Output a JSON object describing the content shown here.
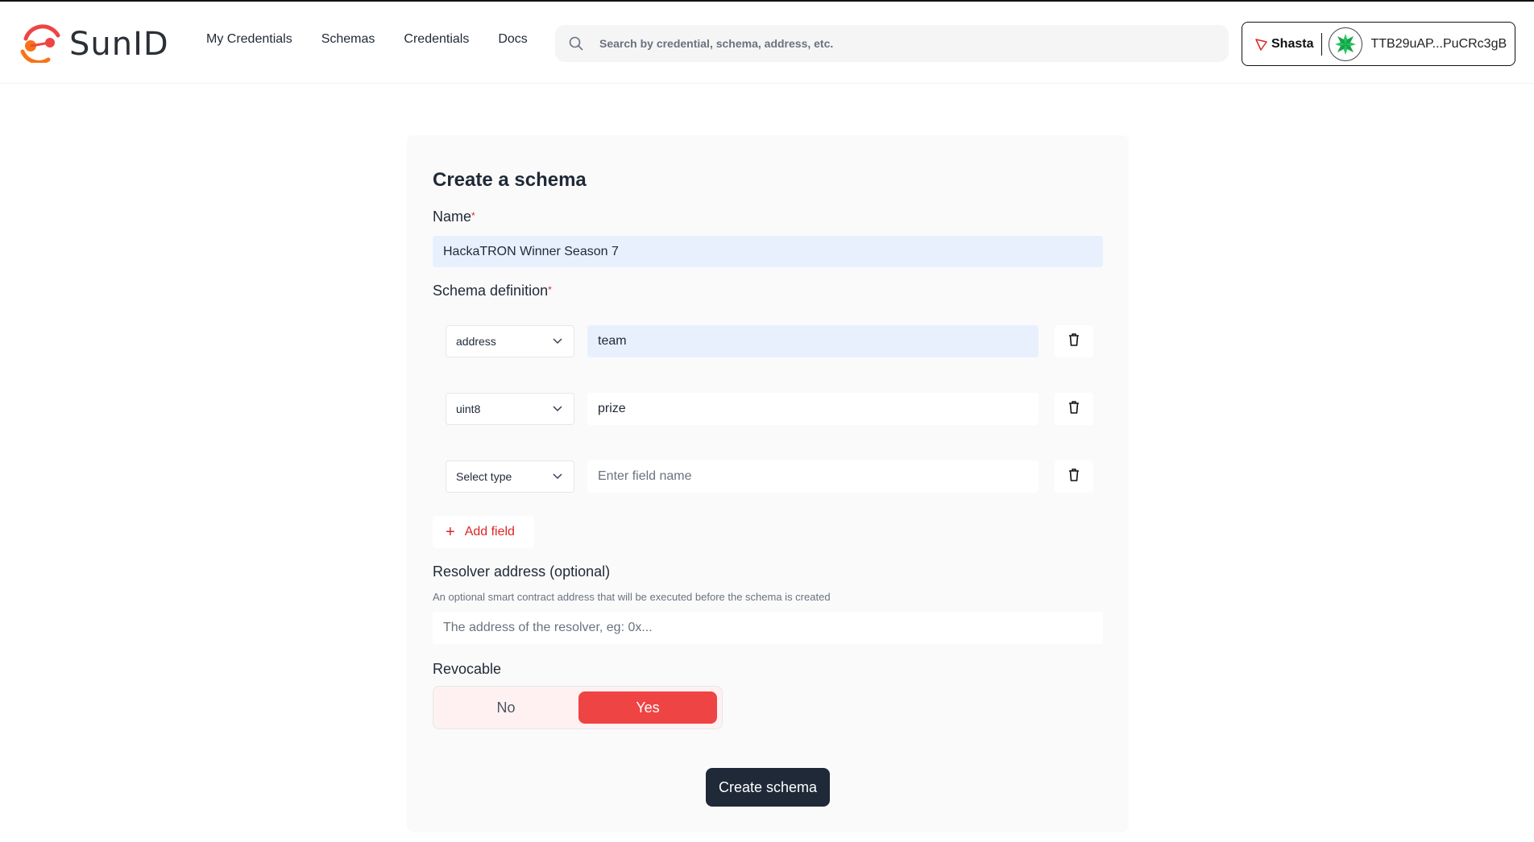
{
  "brand": {
    "name": "SunID"
  },
  "nav": {
    "items": [
      {
        "label": "My Credentials"
      },
      {
        "label": "Schemas"
      },
      {
        "label": "Credentials"
      },
      {
        "label": "Docs"
      }
    ]
  },
  "search": {
    "placeholder": "Search by credential, schema, address, etc."
  },
  "wallet": {
    "network": "Shasta",
    "address": "TTB29uAP...PuCRc3gB"
  },
  "form": {
    "title": "Create a schema",
    "name_label": "Name",
    "name_required": "*",
    "name_value": "HackaTRON Winner Season 7",
    "schema_label": "Schema definition",
    "schema_required": "*",
    "fields": [
      {
        "type": "address",
        "name": "team",
        "placeholder": "Enter field name"
      },
      {
        "type": "uint8",
        "name": "prize",
        "placeholder": "Enter field name"
      },
      {
        "type": "Select type",
        "name": "",
        "placeholder": "Enter field name"
      }
    ],
    "add_field_label": "Add field",
    "resolver_label": "Resolver address (optional)",
    "resolver_help": "An optional smart contract address that will be executed before the schema is created",
    "resolver_placeholder": "The address of the resolver, eg: 0x...",
    "revocable_label": "Revocable",
    "revocable_options": {
      "no": "No",
      "yes": "Yes"
    },
    "revocable_selected": "Yes",
    "submit_label": "Create schema"
  },
  "colors": {
    "accent": "#ef4444",
    "dark_button": "#1f2937",
    "autofill_bg": "#e8f0fe",
    "card_bg": "#fafafa"
  }
}
